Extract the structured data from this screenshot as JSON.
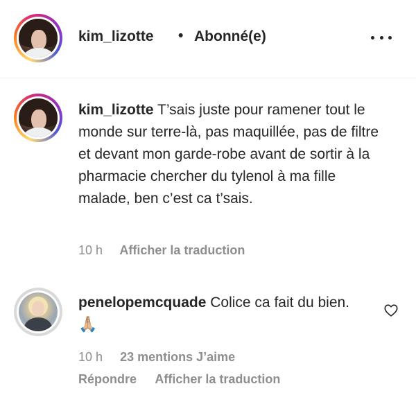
{
  "header": {
    "username": "kim_lizotte",
    "separator": "•",
    "follow_status": "Abonné(e)",
    "more_icon": "more-horizontal-icon"
  },
  "caption": {
    "username": "kim_lizotte",
    "text": "T’sais juste pour ramener tout le monde sur terre-là, pas maquillée, pas de filtre et devant mon garde-robe avant de sortir à la pharmacie chercher du tylenol à ma fille malade, ben c’est ca t’sais.",
    "time": "10 h",
    "translate_label": "Afficher la traduction"
  },
  "comments": [
    {
      "username": "penelopemcquade",
      "text": "Colice ca fait du bien.",
      "emoji": "🙏🏼",
      "time": "10 h",
      "likes": "23 mentions J’aime",
      "reply_label": "Répondre",
      "translate_label": "Afficher la traduction",
      "like_icon": "heart-outline-icon"
    }
  ],
  "colors": {
    "text": "#262626",
    "secondary": "#8e8e8e",
    "divider": "#efefef"
  }
}
